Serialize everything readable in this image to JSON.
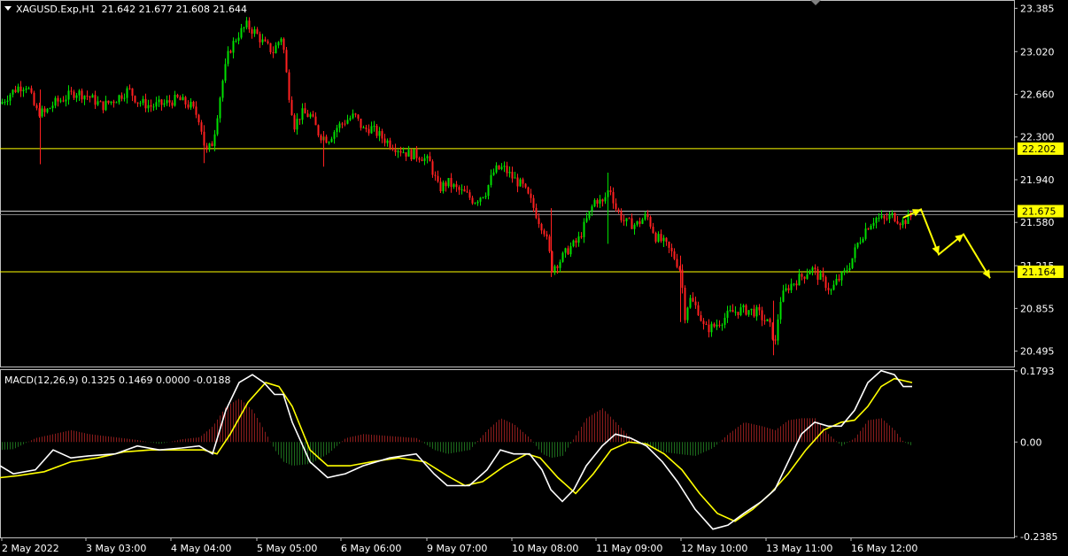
{
  "header": {
    "symbol_line": "XAGUSD.Exp,H1  21.642 21.677 21.608 21.644",
    "macd_line": "MACD(12,26,9) 0.1325 0.1469 0.0000 -0.0188"
  },
  "colors": {
    "background": "#000000",
    "frame": "#c0c0c0",
    "bull": "#00e000",
    "bear": "#ff2020",
    "level": "#ffff00",
    "macd_line": "#ffffff",
    "signal_line": "#ffff00",
    "hist_pos": "#8a1c1c",
    "hist_neg": "#1c6a1c",
    "text": "#ffffff"
  },
  "chart_data": [
    {
      "type": "candlestick",
      "title": "XAGUSD.Exp,H1",
      "ylim": [
        20.38,
        23.44
      ],
      "y_ticks": [
        "23.385",
        "23.020",
        "22.660",
        "22.300",
        "21.940",
        "21.580",
        "21.215",
        "20.855",
        "20.495"
      ],
      "x_ticks": [
        "2 May 2022",
        "3 May 03:00",
        "4 May 04:00",
        "5 May 05:00",
        "6 May 06:00",
        "9 May 07:00",
        "10 May 08:00",
        "11 May 09:00",
        "12 May 10:00",
        "13 May 11:00",
        "16 May 12:00"
      ],
      "price_path": [
        [
          0,
          22.58
        ],
        [
          10,
          22.66
        ],
        [
          20,
          22.72
        ],
        [
          30,
          22.74
        ],
        [
          40,
          22.52
        ],
        [
          50,
          22.5
        ],
        [
          60,
          22.58
        ],
        [
          70,
          22.62
        ],
        [
          85,
          22.68
        ],
        [
          100,
          22.64
        ],
        [
          115,
          22.56
        ],
        [
          130,
          22.62
        ],
        [
          145,
          22.7
        ],
        [
          155,
          22.6
        ],
        [
          170,
          22.56
        ],
        [
          185,
          22.58
        ],
        [
          200,
          22.62
        ],
        [
          215,
          22.56
        ],
        [
          225,
          22.45
        ],
        [
          232,
          22.16
        ],
        [
          240,
          22.26
        ],
        [
          250,
          22.74
        ],
        [
          258,
          23.02
        ],
        [
          268,
          23.16
        ],
        [
          278,
          23.24
        ],
        [
          288,
          23.18
        ],
        [
          298,
          23.08
        ],
        [
          308,
          23.02
        ],
        [
          318,
          23.16
        ],
        [
          325,
          22.7
        ],
        [
          332,
          22.4
        ],
        [
          340,
          22.5
        ],
        [
          350,
          22.48
        ],
        [
          360,
          22.32
        ],
        [
          370,
          22.28
        ],
        [
          380,
          22.38
        ],
        [
          390,
          22.44
        ],
        [
          400,
          22.48
        ],
        [
          410,
          22.36
        ],
        [
          418,
          22.38
        ],
        [
          430,
          22.3
        ],
        [
          445,
          22.22
        ],
        [
          460,
          22.16
        ],
        [
          475,
          22.14
        ],
        [
          485,
          22.08
        ],
        [
          495,
          21.86
        ],
        [
          505,
          21.92
        ],
        [
          515,
          21.86
        ],
        [
          525,
          21.82
        ],
        [
          535,
          21.76
        ],
        [
          548,
          21.84
        ],
        [
          558,
          22.02
        ],
        [
          568,
          22.04
        ],
        [
          578,
          21.96
        ],
        [
          590,
          21.88
        ],
        [
          600,
          21.74
        ],
        [
          608,
          21.6
        ],
        [
          615,
          21.5
        ],
        [
          623,
          21.2
        ],
        [
          632,
          21.26
        ],
        [
          642,
          21.36
        ],
        [
          652,
          21.42
        ],
        [
          662,
          21.6
        ],
        [
          672,
          21.78
        ],
        [
          680,
          21.74
        ],
        [
          688,
          21.88
        ],
        [
          695,
          21.7
        ],
        [
          705,
          21.58
        ],
        [
          718,
          21.56
        ],
        [
          730,
          21.64
        ],
        [
          740,
          21.46
        ],
        [
          750,
          21.4
        ],
        [
          760,
          21.3
        ],
        [
          768,
          21.18
        ],
        [
          773,
          20.8
        ],
        [
          778,
          20.94
        ],
        [
          788,
          20.84
        ],
        [
          795,
          20.68
        ],
        [
          805,
          20.7
        ],
        [
          815,
          20.76
        ],
        [
          825,
          20.82
        ],
        [
          835,
          20.84
        ],
        [
          845,
          20.84
        ],
        [
          855,
          20.82
        ],
        [
          862,
          20.76
        ],
        [
          868,
          20.72
        ],
        [
          875,
          20.56
        ],
        [
          880,
          20.92
        ],
        [
          890,
          21.04
        ],
        [
          900,
          21.1
        ],
        [
          908,
          21.14
        ],
        [
          915,
          21.2
        ],
        [
          922,
          21.14
        ],
        [
          930,
          21.08
        ],
        [
          938,
          21.0
        ],
        [
          944,
          21.08
        ],
        [
          952,
          21.14
        ],
        [
          960,
          21.24
        ],
        [
          968,
          21.4
        ],
        [
          978,
          21.54
        ],
        [
          988,
          21.62
        ],
        [
          998,
          21.6
        ],
        [
          1008,
          21.64
        ],
        [
          1018,
          21.58
        ],
        [
          1026,
          21.62
        ],
        [
          1030,
          21.64
        ]
      ],
      "levels": [
        {
          "label": "22.202",
          "value": 22.202
        },
        {
          "label": "21.675",
          "value": 21.675
        },
        {
          "label": "21.164",
          "value": 21.164
        }
      ],
      "forecast_path": [
        [
          1020,
          21.62
        ],
        [
          1040,
          21.69
        ],
        [
          1060,
          21.31
        ],
        [
          1088,
          21.48
        ],
        [
          1118,
          21.11
        ]
      ]
    },
    {
      "type": "macd",
      "title": "MACD(12,26,9)",
      "ylim": [
        -0.2385,
        0.1793
      ],
      "y_ticks": [
        "0.1793",
        "0.00",
        "-0.2385"
      ],
      "macd_path": [
        [
          0,
          -0.06
        ],
        [
          15,
          -0.08
        ],
        [
          40,
          -0.07
        ],
        [
          60,
          -0.02
        ],
        [
          80,
          -0.04
        ],
        [
          100,
          -0.035
        ],
        [
          130,
          -0.03
        ],
        [
          155,
          -0.01
        ],
        [
          180,
          -0.02
        ],
        [
          205,
          -0.015
        ],
        [
          225,
          -0.01
        ],
        [
          240,
          -0.03
        ],
        [
          255,
          0.08
        ],
        [
          270,
          0.15
        ],
        [
          285,
          0.17
        ],
        [
          298,
          0.15
        ],
        [
          310,
          0.12
        ],
        [
          320,
          0.12
        ],
        [
          330,
          0.05
        ],
        [
          350,
          -0.05
        ],
        [
          370,
          -0.09
        ],
        [
          390,
          -0.08
        ],
        [
          410,
          -0.06
        ],
        [
          440,
          -0.04
        ],
        [
          470,
          -0.03
        ],
        [
          490,
          -0.08
        ],
        [
          505,
          -0.11
        ],
        [
          530,
          -0.11
        ],
        [
          550,
          -0.07
        ],
        [
          565,
          -0.02
        ],
        [
          580,
          -0.03
        ],
        [
          598,
          -0.03
        ],
        [
          612,
          -0.07
        ],
        [
          622,
          -0.12
        ],
        [
          635,
          -0.15
        ],
        [
          648,
          -0.12
        ],
        [
          662,
          -0.06
        ],
        [
          680,
          -0.01
        ],
        [
          695,
          0.02
        ],
        [
          712,
          0.01
        ],
        [
          730,
          -0.01
        ],
        [
          748,
          -0.05
        ],
        [
          765,
          -0.1
        ],
        [
          785,
          -0.17
        ],
        [
          805,
          -0.22
        ],
        [
          822,
          -0.21
        ],
        [
          840,
          -0.18
        ],
        [
          860,
          -0.15
        ],
        [
          875,
          -0.12
        ],
        [
          890,
          -0.05
        ],
        [
          905,
          0.02
        ],
        [
          920,
          0.05
        ],
        [
          935,
          0.04
        ],
        [
          950,
          0.04
        ],
        [
          965,
          0.08
        ],
        [
          980,
          0.15
        ],
        [
          995,
          0.18
        ],
        [
          1010,
          0.17
        ],
        [
          1020,
          0.14
        ],
        [
          1030,
          0.14
        ]
      ],
      "signal_path": [
        [
          0,
          -0.09
        ],
        [
          20,
          -0.085
        ],
        [
          50,
          -0.075
        ],
        [
          80,
          -0.05
        ],
        [
          110,
          -0.04
        ],
        [
          140,
          -0.025
        ],
        [
          170,
          -0.02
        ],
        [
          200,
          -0.02
        ],
        [
          230,
          -0.02
        ],
        [
          245,
          -0.03
        ],
        [
          260,
          0.02
        ],
        [
          280,
          0.1
        ],
        [
          300,
          0.15
        ],
        [
          315,
          0.14
        ],
        [
          330,
          0.09
        ],
        [
          350,
          -0.02
        ],
        [
          370,
          -0.06
        ],
        [
          395,
          -0.06
        ],
        [
          420,
          -0.05
        ],
        [
          450,
          -0.04
        ],
        [
          480,
          -0.05
        ],
        [
          505,
          -0.085
        ],
        [
          525,
          -0.11
        ],
        [
          545,
          -0.1
        ],
        [
          570,
          -0.06
        ],
        [
          595,
          -0.03
        ],
        [
          610,
          -0.04
        ],
        [
          630,
          -0.09
        ],
        [
          650,
          -0.13
        ],
        [
          670,
          -0.08
        ],
        [
          690,
          -0.02
        ],
        [
          710,
          0.0
        ],
        [
          730,
          -0.005
        ],
        [
          750,
          -0.03
        ],
        [
          770,
          -0.07
        ],
        [
          790,
          -0.13
        ],
        [
          810,
          -0.18
        ],
        [
          830,
          -0.2
        ],
        [
          850,
          -0.17
        ],
        [
          870,
          -0.13
        ],
        [
          890,
          -0.08
        ],
        [
          910,
          -0.02
        ],
        [
          930,
          0.03
        ],
        [
          950,
          0.05
        ],
        [
          965,
          0.055
        ],
        [
          980,
          0.09
        ],
        [
          995,
          0.14
        ],
        [
          1010,
          0.16
        ],
        [
          1030,
          0.15
        ]
      ],
      "histogram_path": [
        [
          0,
          -0.02
        ],
        [
          15,
          -0.018
        ],
        [
          40,
          0.01
        ],
        [
          60,
          0.02
        ],
        [
          80,
          0.03
        ],
        [
          100,
          0.02
        ],
        [
          130,
          0.012
        ],
        [
          155,
          0.005
        ],
        [
          180,
          -0.005
        ],
        [
          205,
          0.007
        ],
        [
          225,
          0.012
        ],
        [
          240,
          0.04
        ],
        [
          255,
          0.09
        ],
        [
          270,
          0.11
        ],
        [
          285,
          0.08
        ],
        [
          298,
          0.03
        ],
        [
          310,
          -0.02
        ],
        [
          320,
          -0.05
        ],
        [
          330,
          -0.06
        ],
        [
          350,
          -0.055
        ],
        [
          370,
          -0.03
        ],
        [
          390,
          0.01
        ],
        [
          410,
          0.02
        ],
        [
          440,
          0.015
        ],
        [
          470,
          0.01
        ],
        [
          490,
          -0.02
        ],
        [
          505,
          -0.03
        ],
        [
          530,
          -0.02
        ],
        [
          550,
          0.03
        ],
        [
          565,
          0.06
        ],
        [
          580,
          0.045
        ],
        [
          598,
          0.01
        ],
        [
          612,
          -0.03
        ],
        [
          622,
          -0.04
        ],
        [
          635,
          -0.035
        ],
        [
          648,
          0.01
        ],
        [
          662,
          0.06
        ],
        [
          680,
          0.085
        ],
        [
          695,
          0.05
        ],
        [
          712,
          0.01
        ],
        [
          730,
          -0.01
        ],
        [
          748,
          -0.025
        ],
        [
          765,
          -0.03
        ],
        [
          785,
          -0.035
        ],
        [
          805,
          -0.015
        ],
        [
          822,
          0.02
        ],
        [
          840,
          0.05
        ],
        [
          860,
          0.04
        ],
        [
          875,
          0.03
        ],
        [
          890,
          0.055
        ],
        [
          905,
          0.06
        ],
        [
          920,
          0.06
        ],
        [
          935,
          0.02
        ],
        [
          950,
          -0.01
        ],
        [
          965,
          0.01
        ],
        [
          980,
          0.055
        ],
        [
          995,
          0.06
        ],
        [
          1010,
          0.03
        ],
        [
          1020,
          0.0
        ],
        [
          1030,
          -0.01
        ]
      ]
    }
  ]
}
